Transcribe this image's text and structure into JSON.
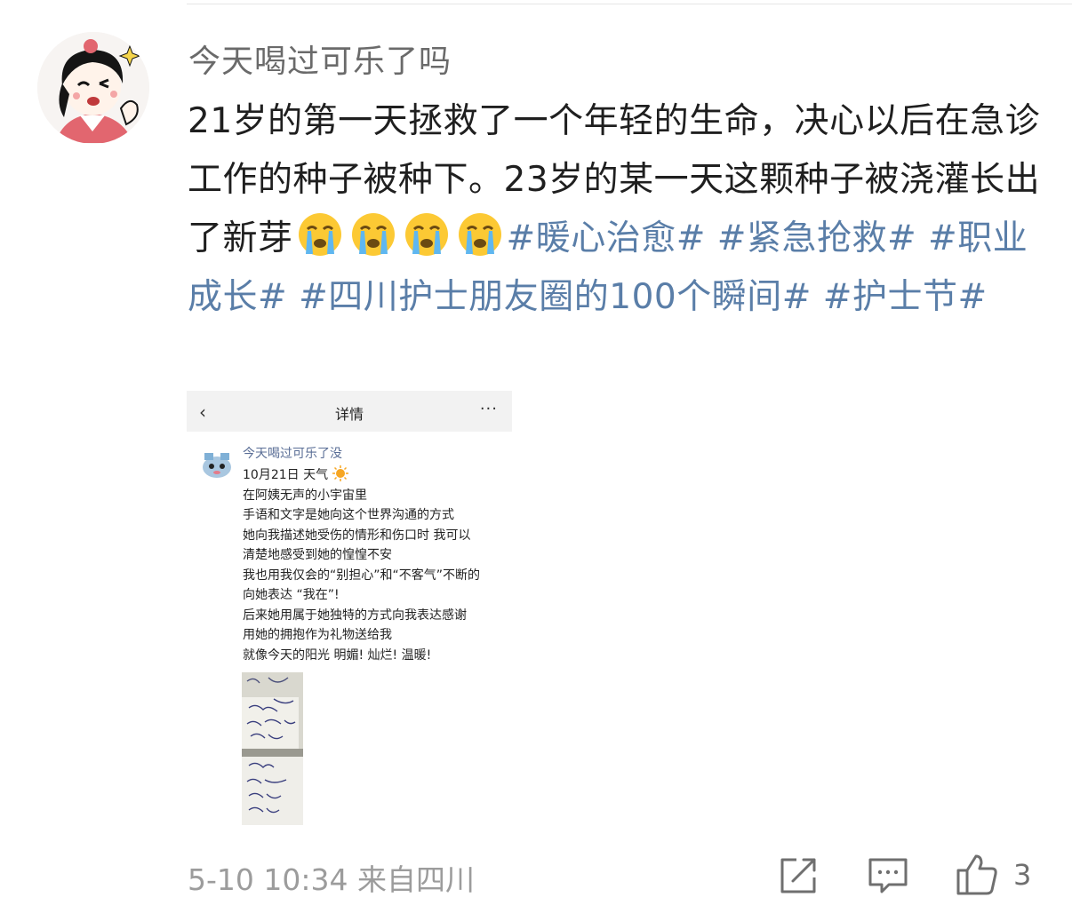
{
  "post": {
    "username": "今天喝过可乐了吗",
    "text_1": "21岁的第一天拯救了一个年轻的生命，决心以后在急诊工作的种子被种下。23岁的某一天这颗种子被浇灌长出了新芽",
    "tags": [
      "#暖心治愈#",
      "#紧急抢救#",
      "#职业成长#",
      "#四川护士朋友圈的100个瞬间#",
      "#护士节#"
    ],
    "emoji_icons": [
      "loudly-crying-face",
      "loudly-crying-face",
      "loudly-crying-face",
      "loudly-crying-face"
    ],
    "meta": "5-10 10:34  来自四川",
    "like_count": "3"
  },
  "screenshot": {
    "back": "‹",
    "title": "详情",
    "more": "···",
    "name": "今天喝过可乐了没",
    "date_weather": "10月21日 天气",
    "lines": [
      "在阿姨无声的小宇宙里",
      "手语和文字是她向这个世界沟通的方式",
      "她向我描述她受伤的情形和伤口时 我可以",
      "清楚地感受到她的惶惶不安",
      "我也用我仅会的“别担心”和“不客气”不断的",
      "向她表达 “我在”!",
      "后来她用属于她独特的方式向我表达感谢",
      "用她的拥抱作为礼物送给我",
      "就像今天的阳光 明媚! 灿烂! 温暖!"
    ]
  },
  "colors": {
    "tag": "#5a7ea8",
    "meta": "#9c9c9c",
    "username": "#6a6a6a"
  }
}
